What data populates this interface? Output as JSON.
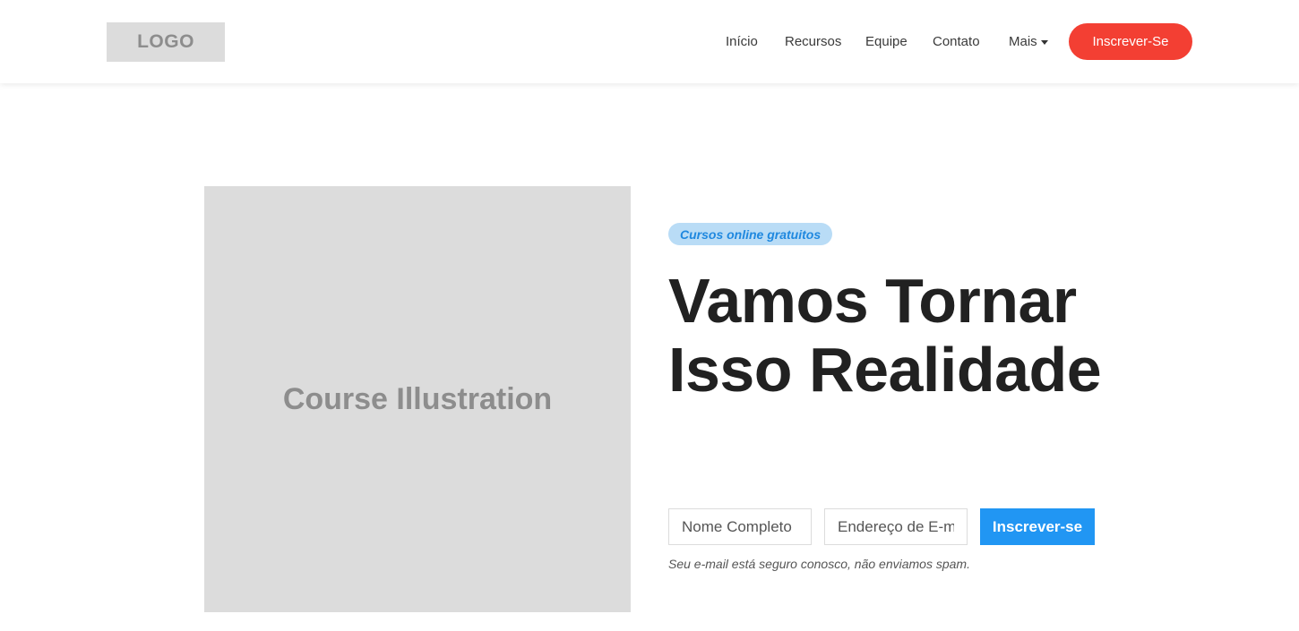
{
  "header": {
    "logo_text": "LOGO",
    "nav": {
      "inicio": "Início",
      "recursos": "Recursos",
      "equipe": "Equipe",
      "contato": "Contato",
      "mais": "Mais"
    },
    "signup_label": "Inscrever-Se"
  },
  "hero": {
    "illustration_label": "Course Illustration",
    "badge": "Cursos online gratuitos",
    "headline": "Vamos Tornar Isso Realidade",
    "form": {
      "name_placeholder": "Nome Completo",
      "email_placeholder": "Endereço de E-mail",
      "submit_label": "Inscrever-se"
    },
    "disclaimer": "Seu e-mail está seguro conosco, não enviamos spam."
  },
  "colors": {
    "primary_red": "#f33f33",
    "primary_blue": "#2196f3",
    "badge_bg": "#b9dcf6",
    "placeholder_gray": "#dcdcdc"
  },
  "icons": {
    "dropdown": "caret-down-icon"
  }
}
